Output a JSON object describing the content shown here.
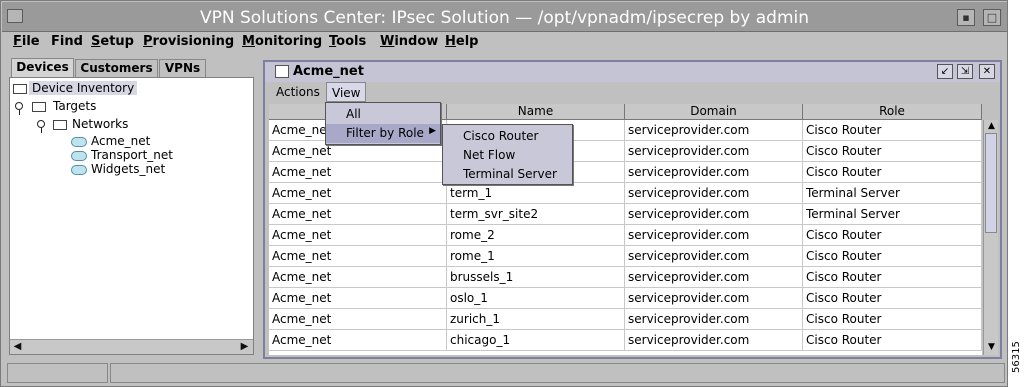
{
  "window": {
    "title": "VPN Solutions Center: IPsec Solution — /opt/vpnadm/ipsecrep by admin",
    "side_id": "56315"
  },
  "menubar": [
    {
      "label": "File",
      "ul": "F",
      "rest": "ile"
    },
    {
      "label": "Find",
      "ul": "",
      "rest": "Find"
    },
    {
      "label": "Setup",
      "ul": "S",
      "rest": "etup"
    },
    {
      "label": "Provisioning",
      "ul": "P",
      "rest": "rovisioning"
    },
    {
      "label": "Monitoring",
      "ul": "M",
      "rest": "onitoring"
    },
    {
      "label": "Tools",
      "ul": "T",
      "rest": "ools"
    },
    {
      "label": "Window",
      "ul": "W",
      "rest": "indow"
    },
    {
      "label": "Help",
      "ul": "H",
      "rest": "elp"
    }
  ],
  "left_tabs": [
    "Devices",
    "Customers",
    "VPNs"
  ],
  "tree": {
    "root": "Device Inventory",
    "targets": "Targets",
    "networks": "Networks",
    "items": [
      "Acme_net",
      "Transport_net",
      "Widgets_net"
    ]
  },
  "frame": {
    "title": "Acme_net",
    "menus": [
      "Actions",
      "View"
    ]
  },
  "view_menu": {
    "items": [
      "All",
      "Filter by Role"
    ]
  },
  "role_submenu": {
    "items": [
      "Cisco Router",
      "Net Flow",
      "Terminal Server"
    ]
  },
  "table": {
    "columns": [
      "",
      "Name",
      "Domain",
      "Role"
    ],
    "rows": [
      [
        "Acme_net",
        "",
        "serviceprovider.com",
        "Cisco Router"
      ],
      [
        "Acme_net",
        "",
        "serviceprovider.com",
        "Cisco Router"
      ],
      [
        "Acme_net",
        "",
        "serviceprovider.com",
        "Cisco Router"
      ],
      [
        "Acme_net",
        "term_1",
        "serviceprovider.com",
        "Terminal Server"
      ],
      [
        "Acme_net",
        "term_svr_site2",
        "serviceprovider.com",
        "Terminal Server"
      ],
      [
        "Acme_net",
        "rome_2",
        "serviceprovider.com",
        "Cisco Router"
      ],
      [
        "Acme_net",
        "rome_1",
        "serviceprovider.com",
        "Cisco Router"
      ],
      [
        "Acme_net",
        "brussels_1",
        "serviceprovider.com",
        "Cisco Router"
      ],
      [
        "Acme_net",
        "oslo_1",
        "serviceprovider.com",
        "Cisco Router"
      ],
      [
        "Acme_net",
        "zurich_1",
        "serviceprovider.com",
        "Cisco Router"
      ],
      [
        "Acme_net",
        "chicago_1",
        "serviceprovider.com",
        "Cisco Router"
      ]
    ]
  }
}
